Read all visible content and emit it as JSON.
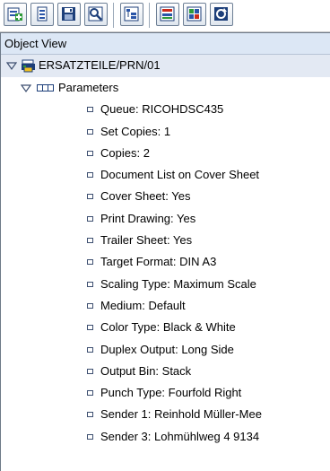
{
  "toolbar": {
    "buttons": [
      {
        "icon": "add-document-icon"
      },
      {
        "icon": "document-icon"
      },
      {
        "icon": "save-icon"
      },
      {
        "icon": "search-icon"
      },
      {
        "icon": "expand-all-icon"
      },
      {
        "icon": "print-preview-icon"
      },
      {
        "icon": "print-icon"
      },
      {
        "icon": "refresh-icon"
      }
    ]
  },
  "panel": {
    "header": "Object View",
    "root": {
      "label": "ERSATZTEILE/PRN/01",
      "icon": "printer-request-icon"
    },
    "parameters": {
      "label": "Parameters",
      "icon": "parameter-list-icon"
    },
    "items": [
      "Queue: RICOHDSC435",
      "Set Copies: 1",
      "Copies: 2",
      "Document List on Cover Sheet",
      "Cover Sheet: Yes",
      "Print Drawing: Yes",
      "Trailer Sheet: Yes",
      "Target Format: DIN A3",
      "Scaling Type: Maximum Scale",
      "Medium: Default",
      "Color Type: Black & White",
      "Duplex Output: Long Side",
      "Output Bin: Stack",
      "Punch Type: Fourfold Right",
      "Sender 1: Reinhold Müller-Mee",
      "Sender 3: Lohmühlweg 4 9134"
    ]
  },
  "colors": {
    "header_bg": "#dce7f5",
    "root_row_bg": "#e3e9f3",
    "toolbar_border": "#6d7f95",
    "icon_green": "#2e9b3a",
    "icon_blue": "#2a55a8",
    "icon_red": "#cc2a1a"
  }
}
